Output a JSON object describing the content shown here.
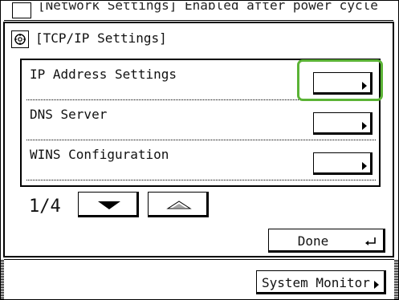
{
  "back_screen": {
    "title": "[Network Settings] Enabled after power cycle"
  },
  "dialog": {
    "title": "[TCP/IP Settings]",
    "icon": "settings-gear-icon"
  },
  "list": {
    "items": [
      {
        "label": "IP Address Settings",
        "highlighted": true
      },
      {
        "label": "DNS Server",
        "highlighted": false
      },
      {
        "label": "WINS Configuration",
        "highlighted": false
      }
    ]
  },
  "pagination": {
    "indicator": "1/4"
  },
  "buttons": {
    "done_label": "Done",
    "system_monitor_label": "System Monitor"
  },
  "colors": {
    "highlight": "#5bb336"
  }
}
